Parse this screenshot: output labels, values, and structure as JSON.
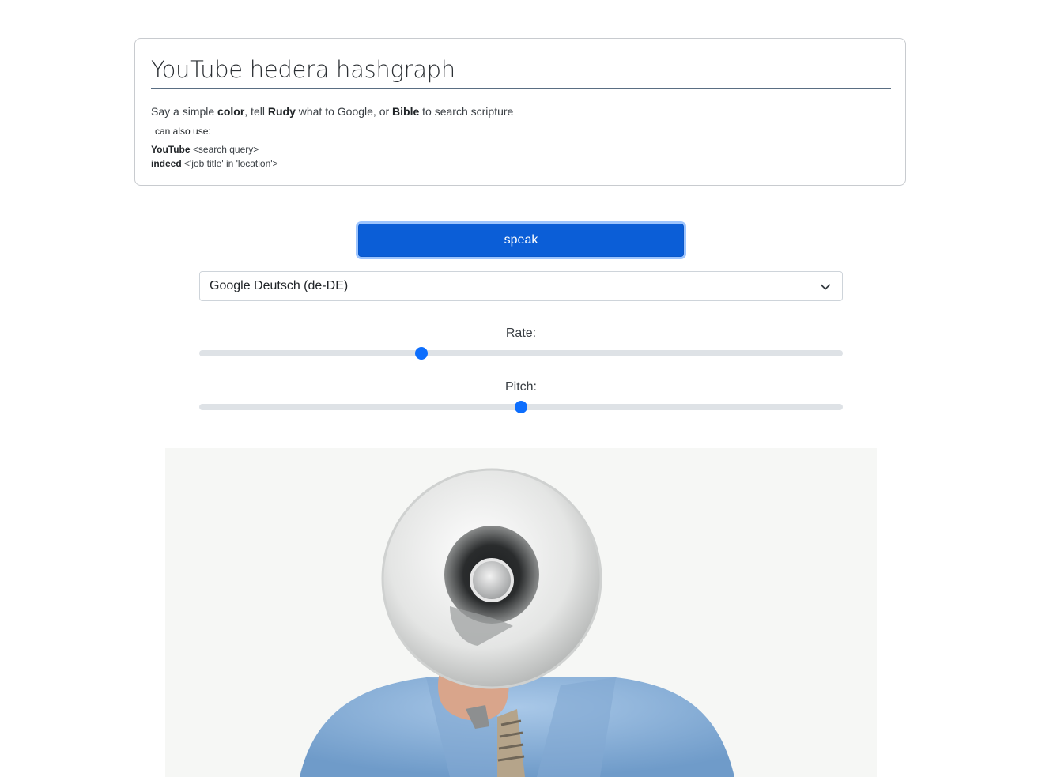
{
  "card": {
    "title": "YouTube hedera hashgraph",
    "instruction": {
      "part1": "Say a simple ",
      "color_word": "color",
      "part2": ", tell ",
      "rudy_word": "Rudy",
      "part3": " what to Google, or ",
      "bible_word": "Bible",
      "part4": " to search scripture"
    },
    "also_label": "can also use:",
    "commands": [
      {
        "keyword": "YouTube",
        "syntax": " <search query>"
      },
      {
        "keyword": "indeed",
        "syntax": " <'job title' in 'location'>"
      }
    ]
  },
  "controls": {
    "speak_label": "speak",
    "voice_selected": "Google Deutsch (de-DE)",
    "rate_label": "Rate:",
    "pitch_label": "Pitch:",
    "rate_fraction": 0.345,
    "pitch_fraction": 0.5
  },
  "image": {
    "alt": "megaphone"
  },
  "colors": {
    "accent": "#0d6efd",
    "button": "#0b5ed7"
  }
}
